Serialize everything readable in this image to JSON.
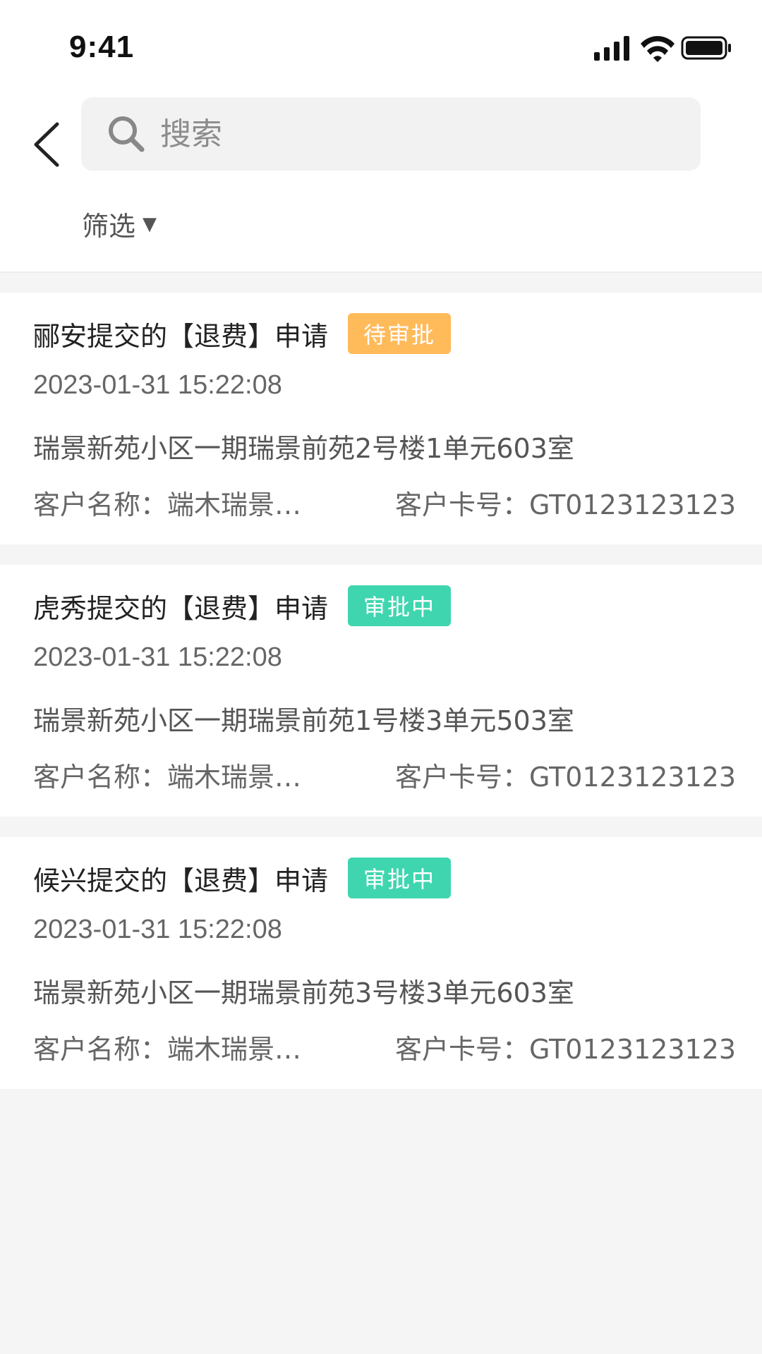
{
  "status_bar": {
    "time": "9:41",
    "icons": [
      "signal-icon",
      "wifi-icon",
      "battery-icon"
    ]
  },
  "header": {
    "back_icon": "chevron-left-icon",
    "search": {
      "placeholder": "搜索",
      "value": "",
      "icon": "search-icon"
    },
    "filter": {
      "label": "筛选",
      "caret": "▼"
    }
  },
  "colors": {
    "pending": "#FFBA5A",
    "in_progress": "#3FD6AF",
    "background": "#F5F5F5"
  },
  "items": [
    {
      "title": "郦安提交的【退费】申请",
      "status": "待审批",
      "status_color": "#FFBA5A",
      "time": "2023-01-31 15:22:08",
      "address": "瑞景新苑小区一期瑞景前苑2号楼1单元603室",
      "customer_name": "客户名称：端木瑞景…",
      "customer_card": "客户卡号：GT0123123123"
    },
    {
      "title": "虎秀提交的【退费】申请",
      "status": "审批中",
      "status_color": "#3FD6AF",
      "time": "2023-01-31 15:22:08",
      "address": "瑞景新苑小区一期瑞景前苑1号楼3单元503室",
      "customer_name": "客户名称：端木瑞景…",
      "customer_card": "客户卡号：GT0123123123"
    },
    {
      "title": "候兴提交的【退费】申请",
      "status": "审批中",
      "status_color": "#3FD6AF",
      "time": "2023-01-31 15:22:08",
      "address": "瑞景新苑小区一期瑞景前苑3号楼3单元603室",
      "customer_name": "客户名称：端木瑞景…",
      "customer_card": "客户卡号：GT0123123123"
    }
  ]
}
